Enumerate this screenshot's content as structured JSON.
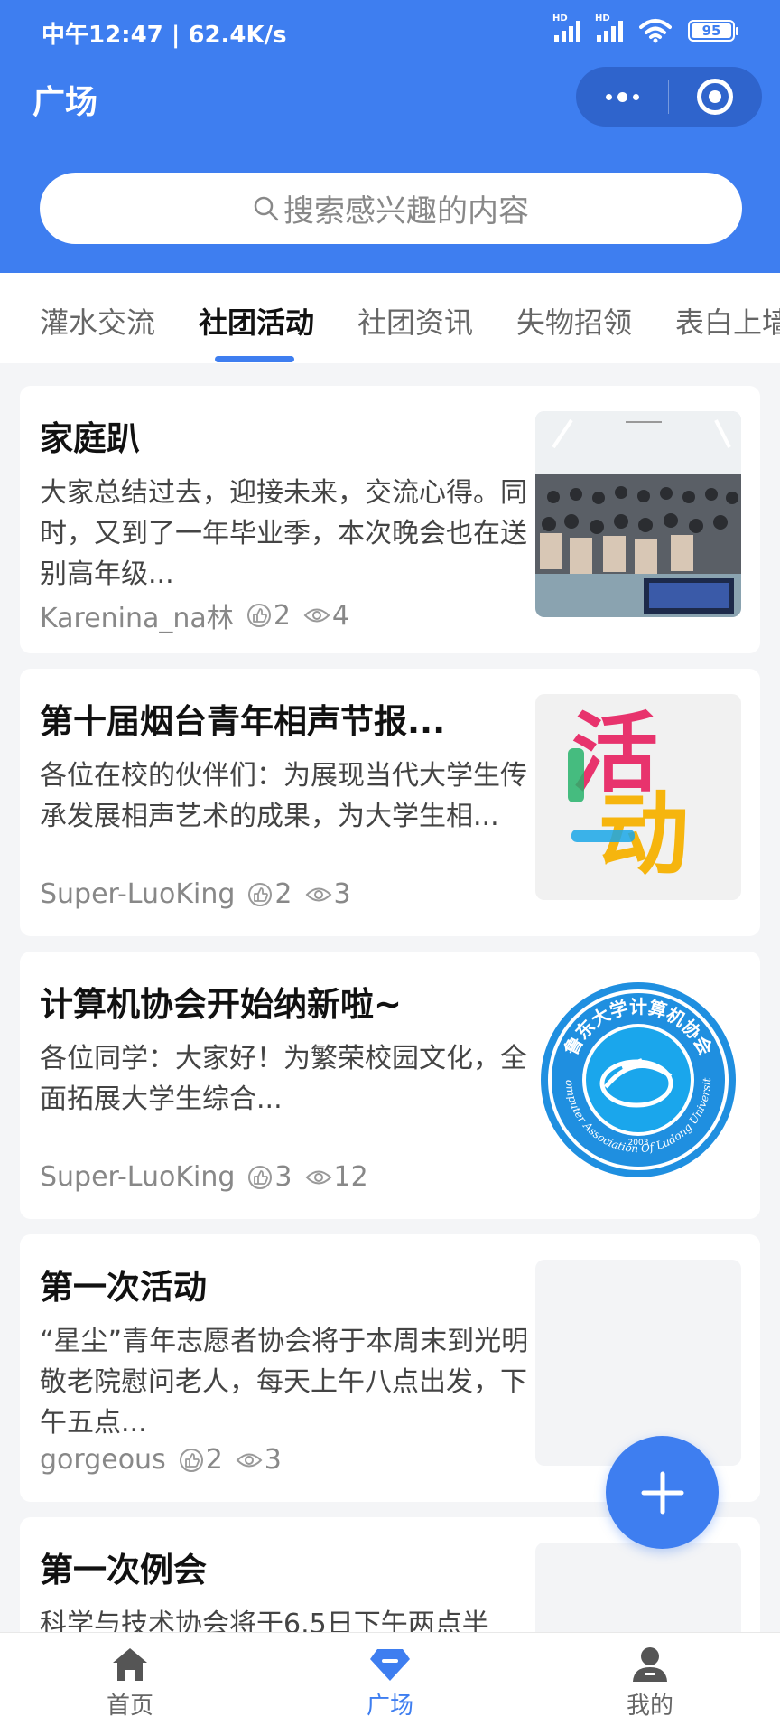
{
  "status_bar": {
    "time": "中午12:47 | 62.4K/s",
    "battery": "95",
    "hd1": "HD",
    "hd2": "HD"
  },
  "header": {
    "title": "广场"
  },
  "search": {
    "placeholder": "搜索感兴趣的内容"
  },
  "tabs": [
    {
      "label": "灌水交流",
      "active": false
    },
    {
      "label": "社团活动",
      "active": true
    },
    {
      "label": "社团资讯",
      "active": false
    },
    {
      "label": "失物招领",
      "active": false
    },
    {
      "label": "表白上墙",
      "active": false
    }
  ],
  "posts": [
    {
      "title": "家庭趴",
      "desc": "大家总结过去，迎接未来，交流心得。同时，又到了一年毕业季，本次晚会也在送别高年级...",
      "author": "Karenina_na林",
      "likes": "2",
      "views": "4",
      "thumb": "group-photo"
    },
    {
      "title": "第十届烟台青年相声节报...",
      "desc": "各位在校的伙伴们：为展现当代大学生传承发展相声艺术的成果，为大学生相...",
      "author": "Super-LuoKing",
      "likes": "2",
      "views": "3",
      "thumb": "活动"
    },
    {
      "title": "计算机协会开始纳新啦~",
      "desc": "各位同学：大家好！为繁荣校园文化，全面拓展大学生综合...",
      "author": "Super-LuoKing",
      "likes": "3",
      "views": "12",
      "thumb": "logo"
    },
    {
      "title": "第一次活动",
      "desc": "“星尘”青年志愿者协会将于本周末到光明敬老院慰问老人，每天上午八点出发，下午五点...",
      "author": "gorgeous",
      "likes": "2",
      "views": "3",
      "thumb": "empty"
    },
    {
      "title": "第一次例会",
      "desc": "科学与技术协会将于6.5日下午两点半",
      "author": "",
      "likes": "",
      "views": "",
      "thumb": "empty"
    }
  ],
  "thumb_text": {
    "huodong_1": "活",
    "huodong_2": "动",
    "logo_cn": "鲁东大学计算机协会",
    "logo_en": "Computer Association Of Ludong University",
    "logo_year": "2003"
  },
  "bottom_nav": [
    {
      "label": "首页",
      "icon": "home-icon",
      "active": false
    },
    {
      "label": "广场",
      "icon": "gem-icon",
      "active": true
    },
    {
      "label": "我的",
      "icon": "user-icon",
      "active": false
    }
  ],
  "colors": {
    "primary": "#3e7ef0",
    "capsule": "#2f64cc",
    "background": "#f4f5f7"
  }
}
